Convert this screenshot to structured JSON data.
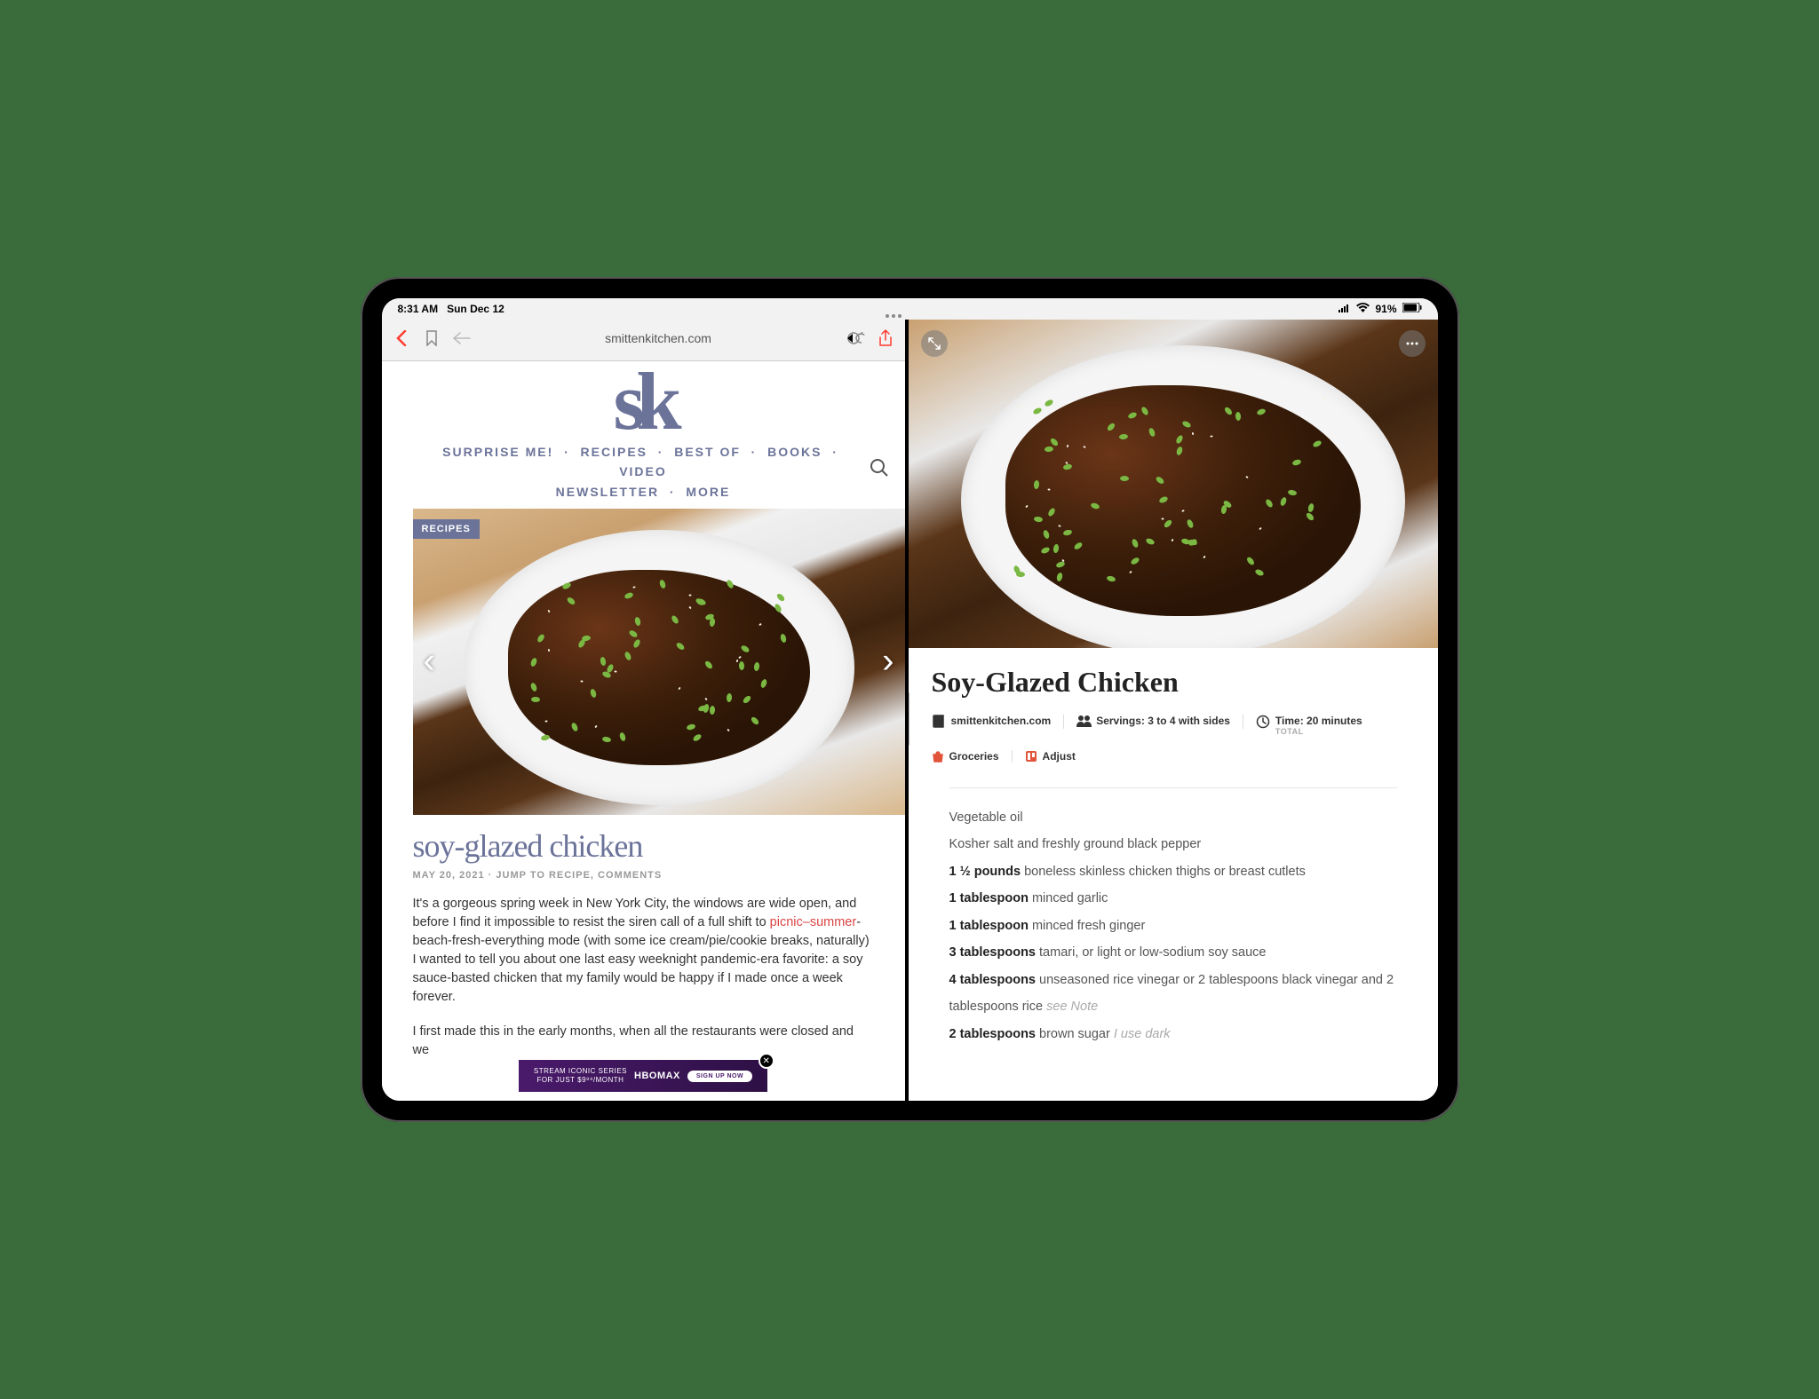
{
  "status": {
    "time": "8:31 AM",
    "date": "Sun Dec 12",
    "battery": "91%"
  },
  "safari": {
    "url": "smittenkitchen.com",
    "nav": {
      "items": [
        "SURPRISE ME!",
        "RECIPES",
        "BEST OF",
        "BOOKS",
        "VIDEO",
        "NEWSLETTER",
        "MORE"
      ]
    },
    "hero": {
      "tag": "RECIPES"
    },
    "article": {
      "title": "soy-glazed chicken",
      "date": "MAY 20, 2021",
      "meta_jump": "JUMP TO RECIPE",
      "meta_comments": "COMMENTS",
      "p1a": "It's a gorgeous spring week in New York City, the windows are wide open, and before I find it impossible to resist the siren call of a full shift to ",
      "link1": "picnic",
      "dash": "–",
      "link2": "summer",
      "p1b": "-beach-fresh-everything mode (with some ice cream/pie/cookie breaks, naturally) I wanted to tell you about one last easy weeknight pandemic-era favorite: a soy sauce-basted chicken that my family would be happy if I made once a week forever.",
      "p2": "I first made this in the early months, when all the restaurants were closed and we"
    },
    "ad": {
      "line1": "STREAM ICONIC SERIES",
      "line2": "FOR JUST $9⁹⁹/MONTH",
      "brand": "HBOMAX",
      "cta": "SIGN UP NOW"
    }
  },
  "recipe": {
    "title": "Soy-Glazed Chicken",
    "source": "smittenkitchen.com",
    "servings": "Servings: 3 to 4 with sides",
    "time": "Time: 20 minutes",
    "time_sub": "TOTAL",
    "actions": {
      "groceries": "Groceries",
      "adjust": "Adjust"
    },
    "ingredients": [
      {
        "qty": "",
        "text": "Vegetable oil"
      },
      {
        "qty": "",
        "text": "Kosher salt and freshly ground black pepper"
      },
      {
        "qty": "1 ½ pounds",
        "text": " boneless skinless chicken thighs or breast cutlets"
      },
      {
        "qty": "1 tablespoon",
        "text": " minced garlic"
      },
      {
        "qty": "1 tablespoon",
        "text": " minced fresh ginger"
      },
      {
        "qty": "3 tablespoons",
        "text": " tamari, or light or low-sodium soy sauce"
      },
      {
        "qty": "4 tablespoons",
        "text": " unseasoned rice vinegar or 2 tablespoons black vinegar and 2 tablespoons rice ",
        "note": "see Note"
      },
      {
        "qty": "2 tablespoons",
        "text": " brown sugar ",
        "note": "I use dark"
      }
    ]
  }
}
